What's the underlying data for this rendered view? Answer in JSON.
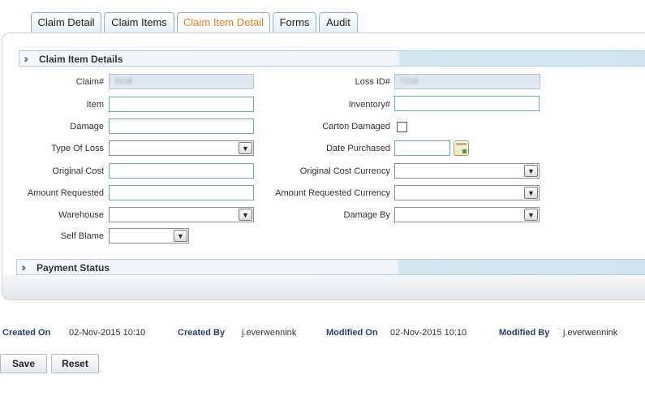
{
  "tabs": [
    {
      "label": "Claim Detail"
    },
    {
      "label": "Claim Items"
    },
    {
      "label": "Claim Item Detail"
    },
    {
      "label": "Forms"
    },
    {
      "label": "Audit"
    }
  ],
  "active_tab": "Claim Item Detail",
  "accent_color": "#e8801d",
  "section_details": {
    "title": "Claim Item Details"
  },
  "section_payment": {
    "title": "Payment Status"
  },
  "fields": {
    "claim_no": {
      "label": "Claim#",
      "value": "1618"
    },
    "loss_id": {
      "label": "Loss ID#",
      "value": "7218"
    },
    "item": {
      "label": "Item",
      "value": ""
    },
    "inventory": {
      "label": "Inventory#",
      "value": ""
    },
    "damage": {
      "label": "Damage",
      "value": ""
    },
    "carton_damaged": {
      "label": "Carton Damaged",
      "checked": false
    },
    "type_of_loss": {
      "label": "Type Of Loss",
      "value": ""
    },
    "date_purchased": {
      "label": "Date Purchased",
      "value": ""
    },
    "original_cost": {
      "label": "Original Cost",
      "value": ""
    },
    "original_cost_currency": {
      "label": "Original Cost Currency",
      "value": ""
    },
    "amount_requested": {
      "label": "Amount Requested",
      "value": ""
    },
    "amount_requested_currency": {
      "label": "Amount Requested Currency",
      "value": ""
    },
    "warehouse": {
      "label": "Warehouse",
      "value": ""
    },
    "damage_by": {
      "label": "Damage By",
      "value": ""
    },
    "self_blame": {
      "label": "Self Blame",
      "value": ""
    }
  },
  "icons": {
    "section_toggle": "double-chevron-right-icon",
    "calendar": "calendar-icon",
    "dropdown": "chevron-down-icon"
  },
  "meta": {
    "created_on_label": "Created On",
    "created_on": "02-Nov-2015 10:10",
    "created_by_label": "Created By",
    "created_by": "j.everwennink",
    "modified_on_label": "Modified On",
    "modified_on": "02-Nov-2015 10:10",
    "modified_by_label": "Modified By",
    "modified_by": "j.everwennink"
  },
  "buttons": {
    "save": "Save",
    "reset": "Reset"
  }
}
